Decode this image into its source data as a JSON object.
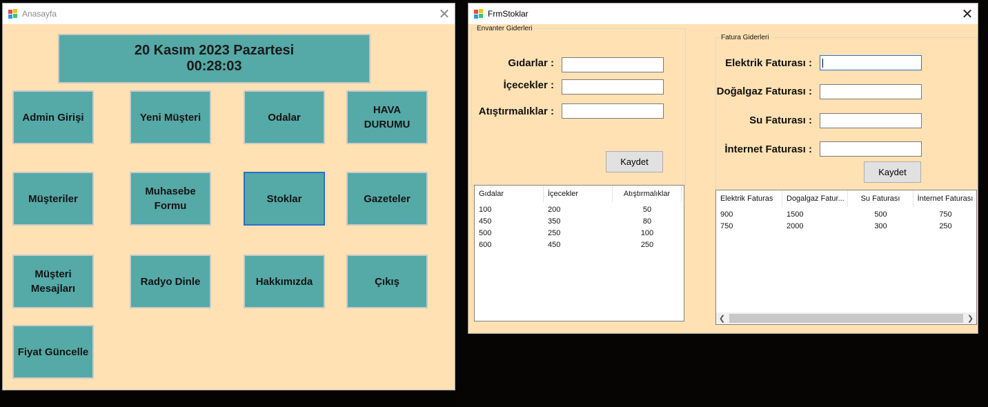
{
  "anasayfa": {
    "title": "Anasayfa",
    "date_line": "20 Kasım 2023 Pazartesi",
    "time_line": "00:28:03",
    "tiles": [
      "Admin Girişi",
      "Yeni Müşteri",
      "Odalar",
      "HAVA\nDURUMU",
      "Müşteriler",
      "Muhasebe\nFormu",
      "Stoklar",
      "Gazeteler",
      "Müşteri\nMesajları",
      "Radyo Dinle",
      "Hakkımızda",
      "Çıkış",
      "Fiyat Güncelle"
    ]
  },
  "frmstoklar": {
    "title": "FrmStoklar",
    "envanter": {
      "caption": "Envanter Giderleri",
      "labels": [
        "Gıdarlar :",
        "İçecekler :",
        "Atıştırmalıklar :"
      ],
      "save_label": "Kaydet",
      "columns": [
        "Gıdalar",
        "İçecekler",
        "Atıştırmalıklar"
      ],
      "rows": [
        [
          "100",
          "200",
          "50"
        ],
        [
          "450",
          "350",
          "80"
        ],
        [
          "500",
          "250",
          "100"
        ],
        [
          "600",
          "450",
          "250"
        ]
      ]
    },
    "fatura": {
      "caption": "Fatura Giderleri",
      "labels": [
        "Elektrik Faturası :",
        "Doğalgaz Faturası :",
        "Su Faturası :",
        "İnternet Faturası :"
      ],
      "save_label": "Kaydet",
      "columns": [
        "Elektrik Faturas",
        "Dogalgaz Fatur...",
        "Su Faturası",
        "İnternet Faturası"
      ],
      "rows": [
        [
          "900",
          "1500",
          "500",
          "750"
        ],
        [
          "750",
          "2000",
          "300",
          "250"
        ]
      ]
    }
  },
  "colors": {
    "form_background": "#ffe1b3",
    "tile": "#55a9a7",
    "focus_border": "#2a70c7"
  },
  "icons": [
    "app-icon",
    "close-icon",
    "scroll-left-icon",
    "scroll-right-icon"
  ]
}
